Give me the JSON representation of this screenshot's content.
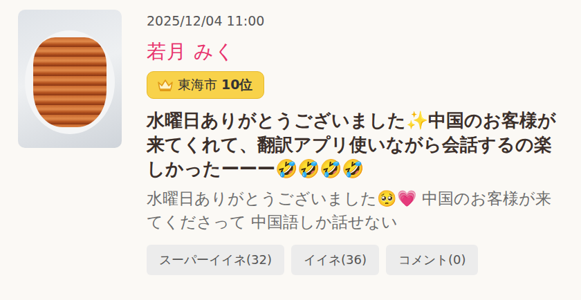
{
  "post": {
    "timestamp": "2025/12/04 11:00",
    "author": "若月 みく",
    "rank": {
      "area": "東海市",
      "position": "10位"
    },
    "title": "水曜日ありがとうございました✨中国のお客様が来てくれて、翻訳アプリ使いながら会話するの楽しかったーーー🤣🤣🤣🤣",
    "excerpt": "水曜日ありがとうございました🥺💗 中国のお客様が来てくださって 中国語しか話せない",
    "actions": [
      {
        "label": "スーパーイイネ(32)"
      },
      {
        "label": "イイネ(36)"
      },
      {
        "label": "コメント(0)"
      }
    ]
  }
}
